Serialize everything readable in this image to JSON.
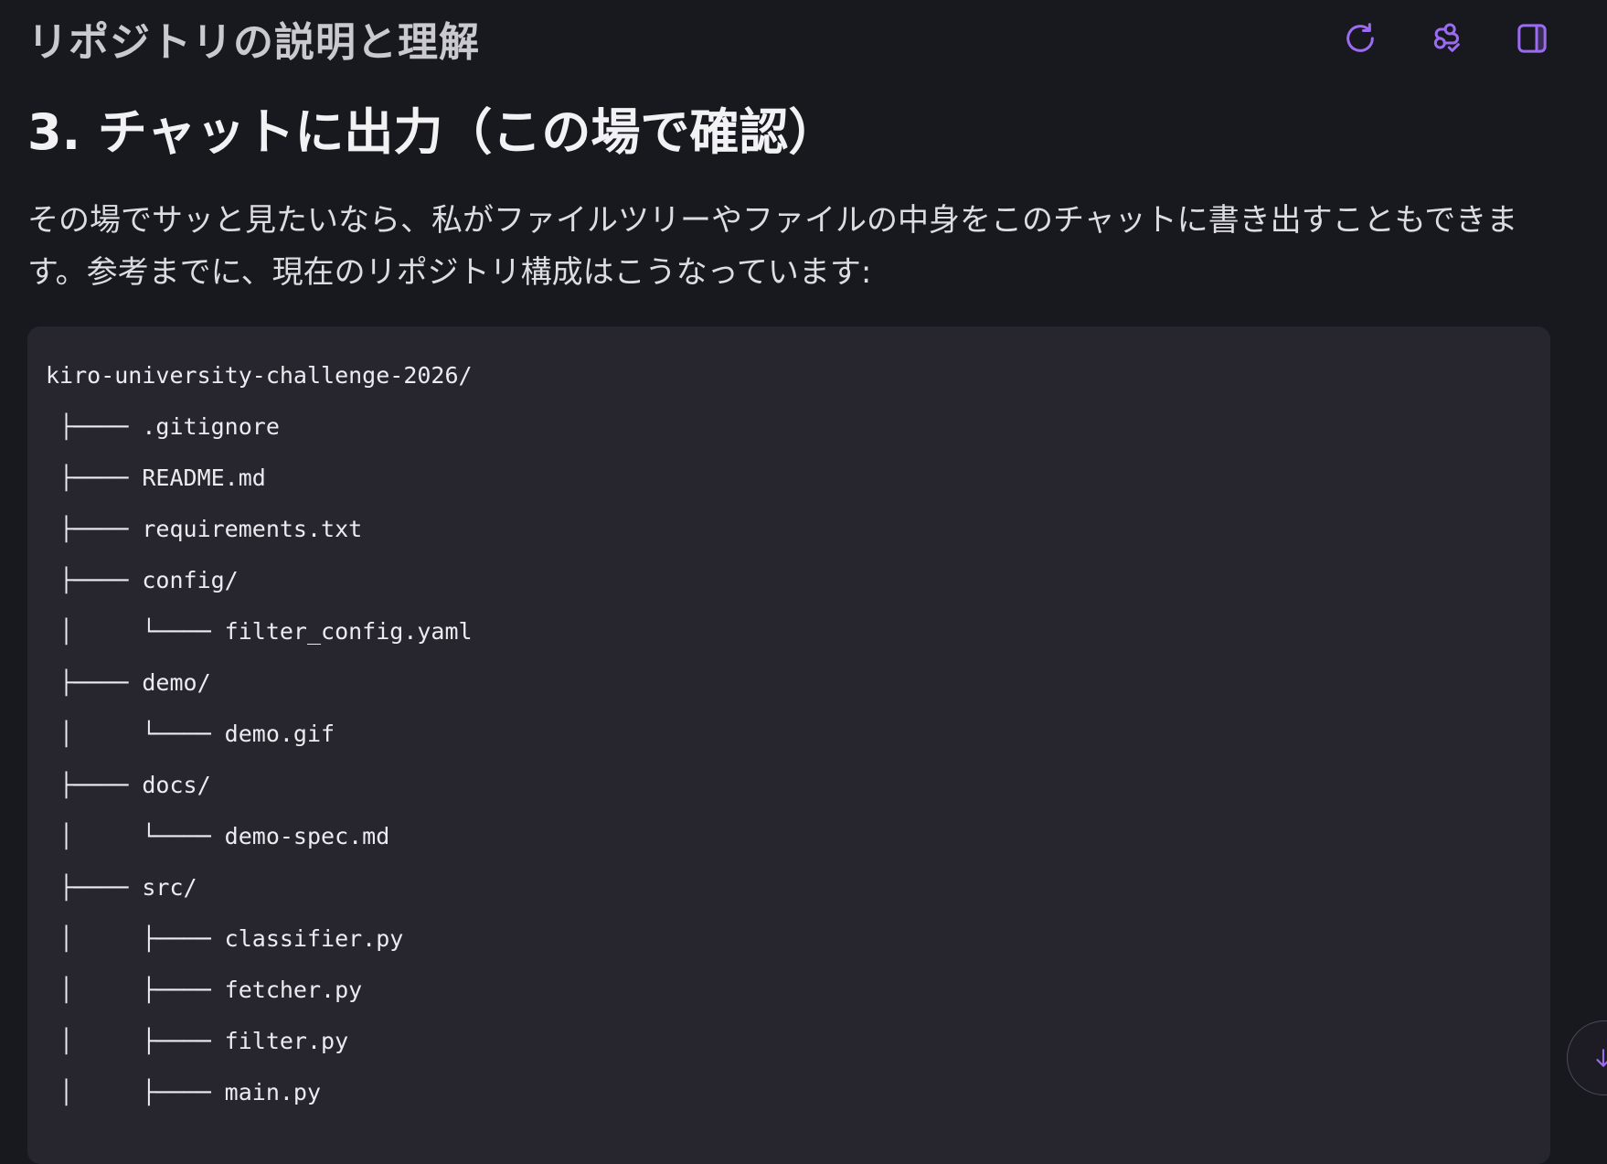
{
  "header": {
    "title": "リポジトリの説明と理解",
    "actions": [
      {
        "icon": "refresh-icon"
      },
      {
        "icon": "steps-icon"
      },
      {
        "icon": "panel-toggle-icon"
      }
    ]
  },
  "colors": {
    "accent": "#9b6cf2",
    "background": "#18181f",
    "code_background": "#27262f"
  },
  "content": {
    "heading": "3. チャットに出力（この場で確認）",
    "paragraph": "その場でサッと見たいなら、私がファイルツリーやファイルの中身をこのチャットに書き出すこともできます。参考までに、現在のリポジトリ構成はこうなっています:",
    "tree": [
      "kiro-university-challenge-2026/",
      " ├──── .gitignore",
      " ├──── README.md",
      " ├──── requirements.txt",
      " ├──── config/",
      " │     └──── filter_config.yaml",
      " ├──── demo/",
      " │     └──── demo.gif",
      " ├──── docs/",
      " │     └──── demo-spec.md",
      " ├──── src/",
      " │     ├──── classifier.py",
      " │     ├──── fetcher.py",
      " │     ├──── filter.py",
      " │     ├──── main.py"
    ]
  },
  "scroll_button": {
    "icon": "arrow-down-icon"
  }
}
